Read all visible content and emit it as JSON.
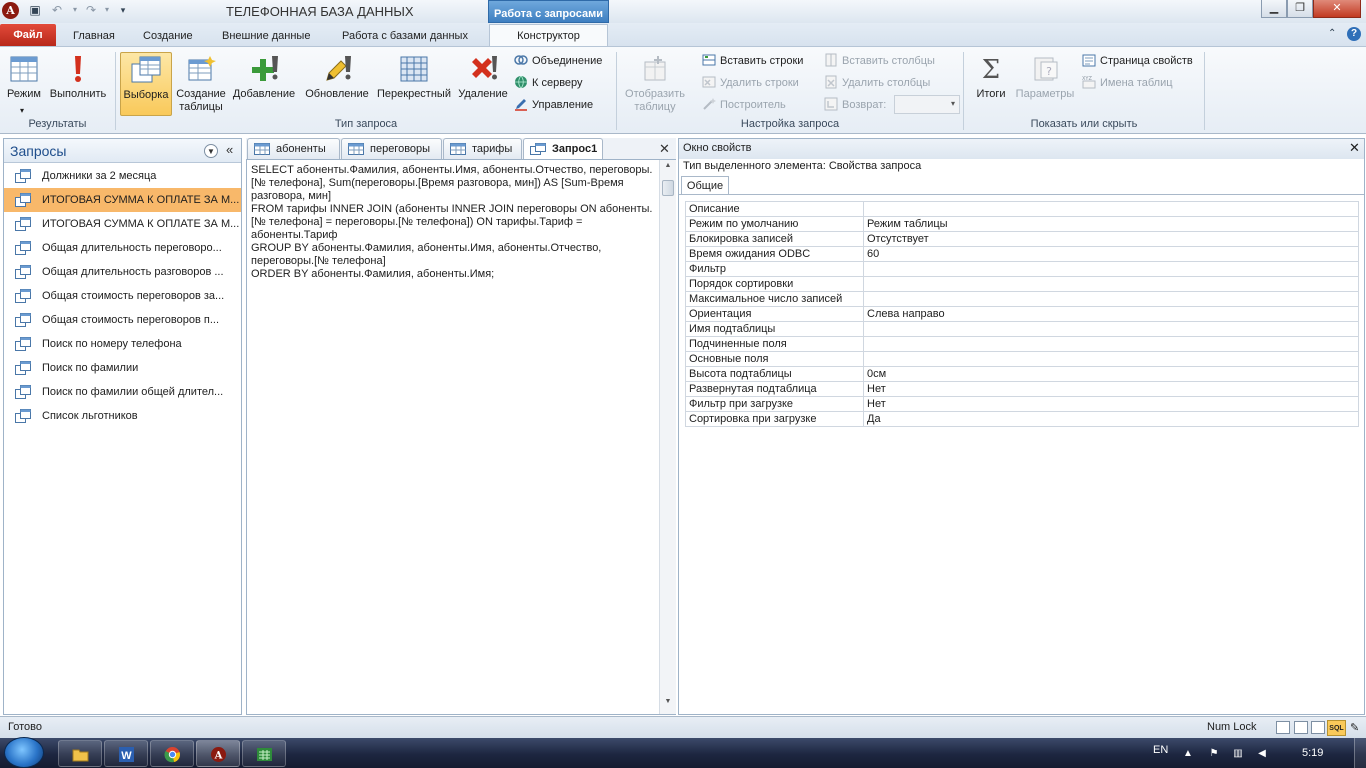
{
  "window": {
    "title": "ТЕЛЕФОННАЯ БАЗА ДАННЫХ",
    "context_tab_title": "Работа с запросами",
    "min_glyph": "▁",
    "max_glyph": "❐",
    "close_glyph": "✕"
  },
  "ribbon_tabs": [
    "Файл",
    "Главная",
    "Создание",
    "Внешние данные",
    "Работа с базами данных",
    "Конструктор"
  ],
  "ribbon": {
    "results": {
      "label": "Результаты",
      "mode": "Режим",
      "run": "Выполнить"
    },
    "query_type": {
      "label": "Тип запроса",
      "select": "Выборка",
      "make_table_1": "Создание",
      "make_table_2": "таблицы",
      "append": "Добавление",
      "update": "Обновление",
      "crosstab": "Перекрестный",
      "delete": "Удаление",
      "union": "Объединение",
      "pass_through": "К серверу",
      "data_definition": "Управление"
    },
    "query_setup": {
      "label": "Настройка запроса",
      "show_table_1": "Отобразить",
      "show_table_2": "таблицу",
      "insert_rows": "Вставить строки",
      "delete_rows": "Удалить строки",
      "builder": "Построитель",
      "insert_columns": "Вставить столбцы",
      "delete_columns": "Удалить столбцы",
      "return": "Возврат:"
    },
    "show_hide": {
      "label": "Показать или скрыть",
      "totals": "Итоги",
      "parameters": "Параметры",
      "property_sheet": "Страница свойств",
      "table_names": "Имена таблиц"
    }
  },
  "nav_pane": {
    "title": "Запросы",
    "items": [
      "Должники за 2 месяца",
      "ИТОГОВАЯ СУММА К ОПЛАТЕ ЗА М...",
      "ИТОГОВАЯ СУММА К ОПЛАТЕ ЗА М...",
      "Общая длительность переговоро...",
      "Общая длительность разговоров ...",
      "Общая стоимость переговоров за...",
      "Общая стоимость переговоров п...",
      "Поиск по номеру телефона",
      "Поиск по фамилии",
      "Поиск по фамилии общей длител...",
      "Список льготников"
    ],
    "selected_index": 1
  },
  "doc_tabs": [
    "абоненты",
    "переговоры",
    "тарифы",
    "Запрос1"
  ],
  "sql_text": "SELECT абоненты.Фамилия, абоненты.Имя, абоненты.Отчество, переговоры.[№ телефона], Sum(переговоры.[Время разговора, мин]) AS [Sum-Время разговора, мин]\nFROM тарифы INNER JOIN (абоненты INNER JOIN переговоры ON абоненты.[№ телефона] = переговоры.[№ телефона]) ON тарифы.Тариф = абоненты.Тариф\nGROUP BY абоненты.Фамилия, абоненты.Имя, абоненты.Отчество, переговоры.[№ телефона]\nORDER BY абоненты.Фамилия, абоненты.Имя;",
  "property_sheet": {
    "title": "Окно свойств",
    "selection_type": "Тип выделенного элемента:  Свойства запроса",
    "tab": "Общие",
    "rows": [
      {
        "k": "Описание",
        "v": ""
      },
      {
        "k": "Режим по умолчанию",
        "v": "Режим таблицы"
      },
      {
        "k": "Блокировка записей",
        "v": "Отсутствует"
      },
      {
        "k": "Время ожидания ODBC",
        "v": "60"
      },
      {
        "k": "Фильтр",
        "v": ""
      },
      {
        "k": "Порядок сортировки",
        "v": ""
      },
      {
        "k": "Максимальное число записей",
        "v": ""
      },
      {
        "k": "Ориентация",
        "v": "Слева направо"
      },
      {
        "k": "Имя подтаблицы",
        "v": ""
      },
      {
        "k": "Подчиненные поля",
        "v": ""
      },
      {
        "k": "Основные поля",
        "v": ""
      },
      {
        "k": "Высота подтаблицы",
        "v": "0см"
      },
      {
        "k": "Развернутая подтаблица",
        "v": "Нет"
      },
      {
        "k": "Фильтр при загрузке",
        "v": "Нет"
      },
      {
        "k": "Сортировка при загрузке",
        "v": "Да"
      }
    ]
  },
  "status": {
    "text": "Готово",
    "num_lock": "Num Lock",
    "sql_view": "SQL"
  },
  "taskbar": {
    "lang": "EN",
    "clock": "5:19"
  },
  "colors": {
    "file_tab": "#c8321f",
    "selected_nav": "#f8b86a",
    "context_tab": "#4a8bd0",
    "taskbar": "#1d2640"
  }
}
